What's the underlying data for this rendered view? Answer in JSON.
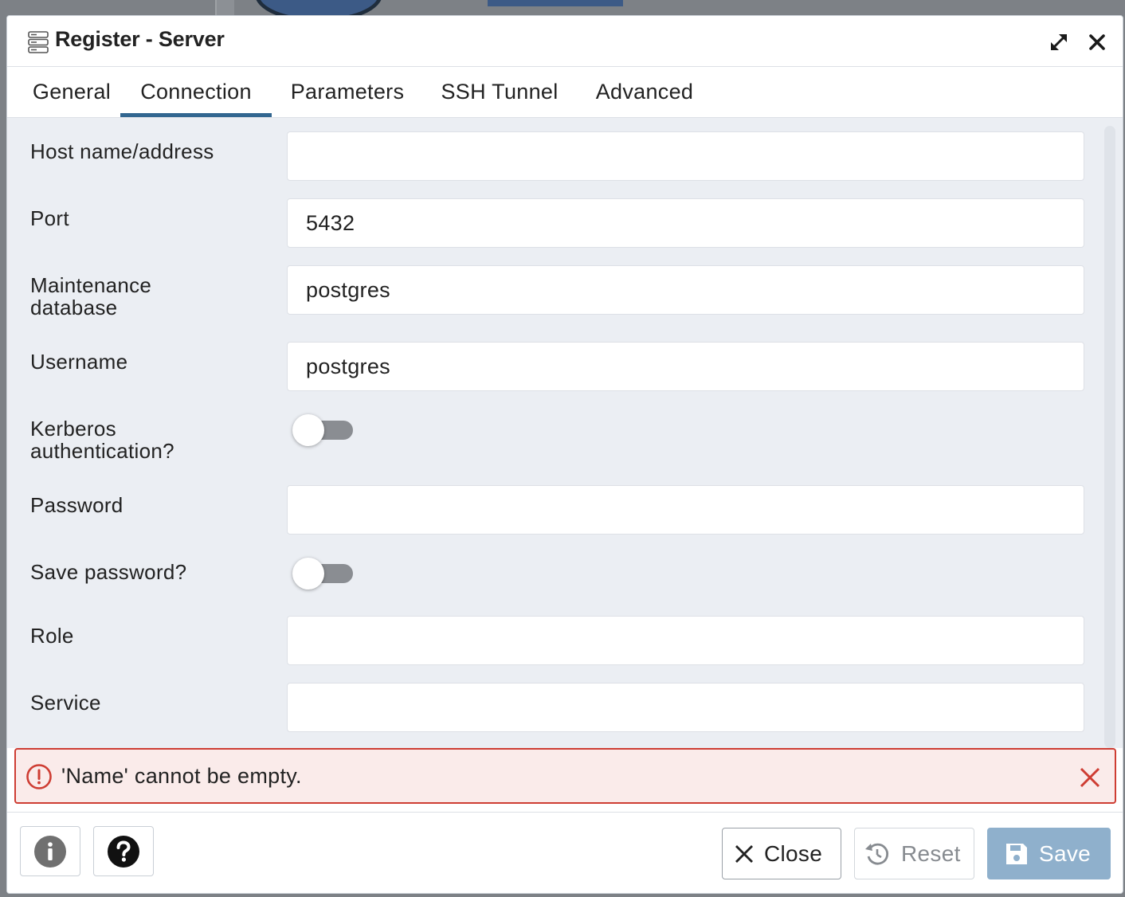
{
  "dialog": {
    "title": "Register - Server",
    "title_icon": "server-icon",
    "expand_icon": "expand-icon",
    "close_icon": "close-icon"
  },
  "tabs": [
    {
      "label": "General",
      "active": false
    },
    {
      "label": "Connection",
      "active": true
    },
    {
      "label": "Parameters",
      "active": false
    },
    {
      "label": "SSH Tunnel",
      "active": false
    },
    {
      "label": "Advanced",
      "active": false
    }
  ],
  "form": {
    "host": {
      "label": "Host name/address",
      "value": ""
    },
    "port": {
      "label": "Port",
      "value": "5432"
    },
    "maintenance_db": {
      "label_line1": "Maintenance",
      "label_line2": "database",
      "value": "postgres"
    },
    "username": {
      "label": "Username",
      "value": "postgres"
    },
    "kerberos": {
      "label_line1": "Kerberos",
      "label_line2": "authentication?",
      "enabled": false
    },
    "password": {
      "label": "Password",
      "value": ""
    },
    "save_password": {
      "label": "Save password?",
      "enabled": false
    },
    "role": {
      "label": "Role",
      "value": ""
    },
    "service": {
      "label": "Service",
      "value": ""
    }
  },
  "error": {
    "message": "'Name' cannot be empty.",
    "icon": "alert-circle-icon",
    "color": "#ce3d33",
    "background": "#faebea"
  },
  "footer": {
    "info_icon": "info-icon",
    "help_icon": "help-icon",
    "close_label": "Close",
    "reset_label": "Reset",
    "save_label": "Save"
  },
  "colors": {
    "accent": "#326690",
    "save_button": "#8fb0cc",
    "form_background": "#ebeef3"
  }
}
